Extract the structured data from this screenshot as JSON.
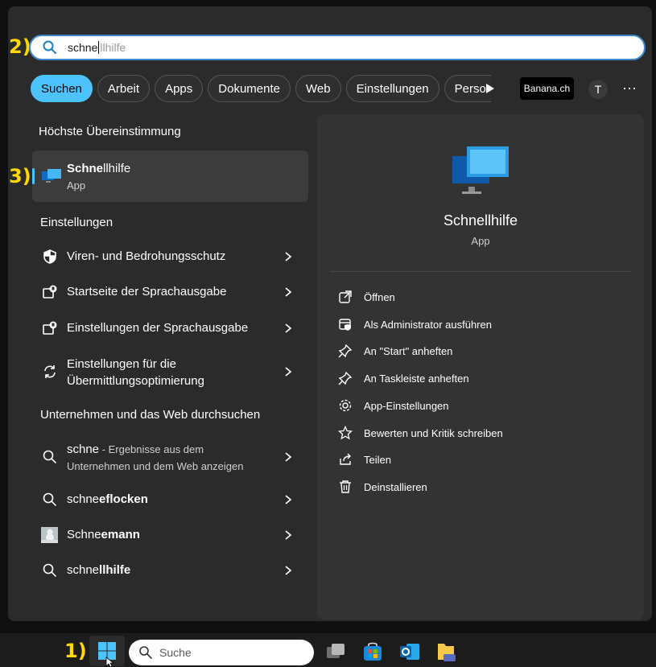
{
  "annotations": [
    "2)",
    "3)",
    "1)"
  ],
  "search": {
    "typed": "schne",
    "completion": "llhilfe"
  },
  "chips": [
    "Suchen",
    "Arbeit",
    "Apps",
    "Dokumente",
    "Web",
    "Einstellungen",
    "Perso"
  ],
  "brand_label": "Banana.ch",
  "avatar_initial": "T",
  "more_label": "···",
  "left": {
    "best_match_title": "Höchste Übereinstimmung",
    "best_match": {
      "name_bold": "Schne",
      "name_rest": "llhilfe",
      "type": "App"
    },
    "settings_title": "Einstellungen",
    "settings": [
      {
        "label": "Viren- und Bedrohungsschutz",
        "icon": "shield-icon"
      },
      {
        "label": "Startseite der Sprachausgabe",
        "icon": "narrator-icon"
      },
      {
        "label": "Einstellungen der Sprachausgabe",
        "icon": "narrator-icon"
      },
      {
        "label_line1": "Einstellungen für die",
        "label_line2": "Übermittlungsoptimierung",
        "icon": "sync-icon"
      }
    ],
    "web_title": "Unternehmen und das Web durchsuchen",
    "web": [
      {
        "query": "schne",
        "suffix": " - Ergebnisse aus dem",
        "line2": "Unternehmen und dem Web anzeigen"
      },
      {
        "query": "schne",
        "rest": "eflocken"
      },
      {
        "query": "Schne",
        "rest": "emann"
      },
      {
        "query": "schne",
        "rest": "llhilfe"
      }
    ]
  },
  "detail": {
    "name": "Schnellhilfe",
    "type": "App",
    "actions": [
      {
        "label": "Öffnen",
        "icon": "open-external-icon"
      },
      {
        "label": "Als Administrator ausführen",
        "icon": "admin-shield-icon"
      },
      {
        "label": "An \"Start\" anheften",
        "icon": "pin-icon"
      },
      {
        "label": "An Taskleiste anheften",
        "icon": "pin-icon"
      },
      {
        "label": "App-Einstellungen",
        "icon": "gear-icon"
      },
      {
        "label": "Bewerten und Kritik schreiben",
        "icon": "star-icon"
      },
      {
        "label": "Teilen",
        "icon": "share-icon"
      },
      {
        "label": "Deinstallieren",
        "icon": "trash-icon"
      }
    ]
  },
  "taskbar": {
    "search_placeholder": "Suche",
    "apps": [
      "start-icon",
      "task-view-icon",
      "store-icon",
      "outlook-icon",
      "dev-folder-icon"
    ]
  },
  "colors": {
    "accent": "#4cc2ff",
    "annotation": "#ffd900",
    "panel": "#2b2b2b"
  }
}
